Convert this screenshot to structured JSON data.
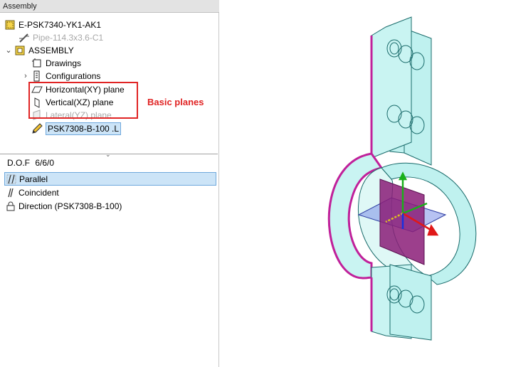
{
  "panel": {
    "title": "Assembly"
  },
  "tree": {
    "items": [
      {
        "label": "E-PSK7340-YK1-AK1",
        "icon": "assembly-root-icon",
        "state": "normal"
      },
      {
        "label": "Pipe-114.3x3.6-C1",
        "icon": "pipe-icon",
        "state": "disabled"
      },
      {
        "label": "ASSEMBLY",
        "icon": "assembly-folder-icon",
        "state": "expanded"
      },
      {
        "label": "Drawings",
        "icon": "drawings-icon",
        "state": "normal"
      },
      {
        "label": "Configurations",
        "icon": "configurations-icon",
        "state": "collapsed"
      },
      {
        "label": "Horizontal(XY) plane",
        "icon": "horizontal-plane-icon",
        "state": "normal"
      },
      {
        "label": "Vertical(XZ) plane",
        "icon": "vertical-plane-icon",
        "state": "normal"
      },
      {
        "label": "Lateral(YZ) plane",
        "icon": "lateral-plane-icon",
        "state": "disabled"
      },
      {
        "label": "PSK7308-B-100 .L",
        "icon": "part-pencil-icon",
        "state": "selected"
      }
    ]
  },
  "callout": {
    "text": "Basic planes",
    "color": "#e02424"
  },
  "dof": {
    "label": "D.O.F",
    "value": "6/6/0",
    "constraints": [
      {
        "label": "Parallel",
        "icon": "parallel-icon",
        "selected": true
      },
      {
        "label": "Coincident",
        "icon": "coincident-icon",
        "selected": false
      },
      {
        "label": "Direction (PSK7308-B-100)",
        "icon": "lock-icon",
        "selected": false
      }
    ]
  },
  "colors": {
    "part_fill": "#bff1ef",
    "part_edge": "#1a6b6b",
    "highlight_edge": "#c0209a",
    "plane_vertical": "#8b1d78",
    "plane_horizontal": "#7b8fe8",
    "axis_x": "#e01818",
    "axis_y": "#1ab01a",
    "axis_z": "#1830e0"
  }
}
